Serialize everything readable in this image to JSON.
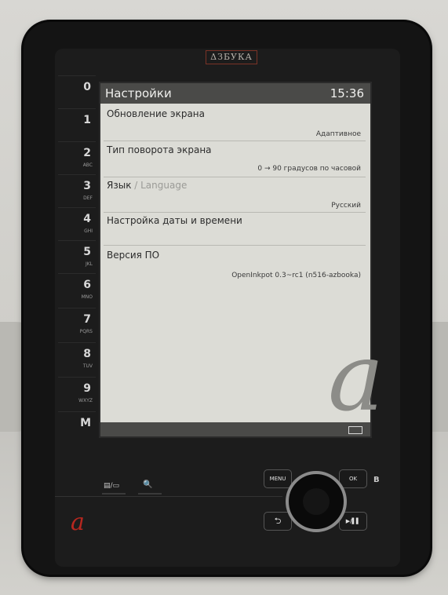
{
  "device": {
    "brand": "ΔЗБУКА",
    "keys": [
      {
        "num": "0",
        "sub": ""
      },
      {
        "num": "1",
        "sub": ""
      },
      {
        "num": "2",
        "sub": "ABC"
      },
      {
        "num": "3",
        "sub": "DEF"
      },
      {
        "num": "4",
        "sub": "GHI"
      },
      {
        "num": "5",
        "sub": "JKL"
      },
      {
        "num": "6",
        "sub": "MNO"
      },
      {
        "num": "7",
        "sub": "PQRS"
      },
      {
        "num": "8",
        "sub": "TUV"
      },
      {
        "num": "9",
        "sub": "WXYZ"
      },
      {
        "num": "M",
        "sub": ""
      }
    ],
    "buttons": {
      "menu": "MENU",
      "ok": "OK",
      "ok_side": "B",
      "back": "⮌",
      "play": "▶/▌▌",
      "page_toggle": "▤/▭",
      "zoom": "🔍"
    }
  },
  "screen": {
    "title": "Настройки",
    "clock": "15:36",
    "items": [
      {
        "label": "Обновление экрана",
        "value": "Адаптивное"
      },
      {
        "label": "Тип поворота экрана",
        "value": "0 → 90 градусов по часовой"
      },
      {
        "label": "Язык",
        "label_faded": " / Language",
        "value": "Русский"
      },
      {
        "label": "Настройка даты и времени",
        "value": ""
      },
      {
        "label": "Версия ПО",
        "value": "OpenInkpot 0.3~rc1 (n516-azbooka)"
      }
    ]
  },
  "colors": {
    "screen_bg": "#dcdcd6",
    "titlebar": "#4a4a48",
    "brand_red": "#b6271f"
  }
}
